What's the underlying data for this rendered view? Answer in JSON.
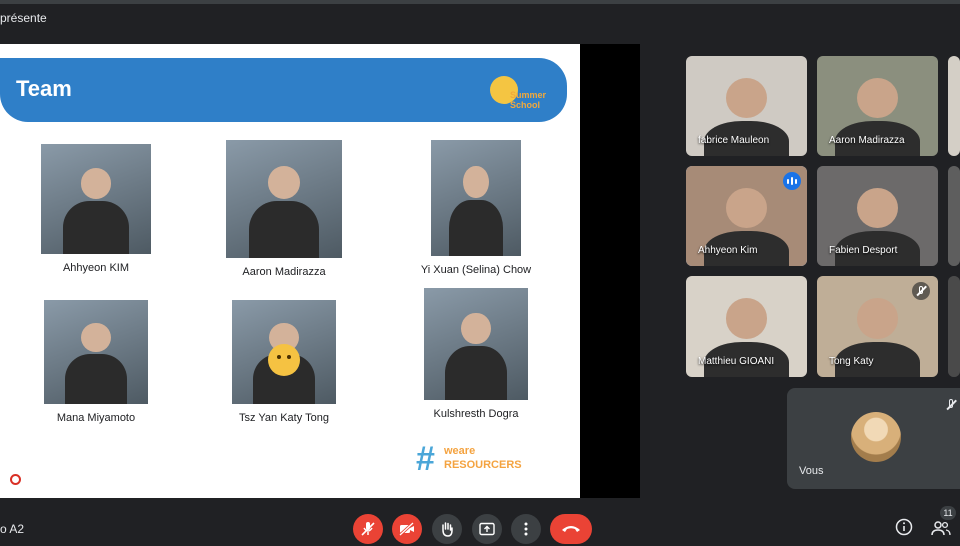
{
  "top_bar": {
    "presenting_label": "présente"
  },
  "slide": {
    "title": "Team",
    "logo_text": "Summer School",
    "hashtag_text": "weare RESOURCERS",
    "members": [
      {
        "name": "Ahhyeon KIM"
      },
      {
        "name": "Aaron Madirazza"
      },
      {
        "name": "Yi Xuan (Selina) Chow"
      },
      {
        "name": "Mana Miyamoto"
      },
      {
        "name": "Tsz Yan Katy Tong"
      },
      {
        "name": "Kulshresth Dogra"
      }
    ]
  },
  "participants": [
    {
      "name": "fabrice Mauleon",
      "speaking": false,
      "muted": false,
      "bg": "#cfcac3"
    },
    {
      "name": "Aaron Madirazza",
      "speaking": false,
      "muted": false,
      "bg": "#8b8f7e"
    },
    {
      "name": "Ahhyeon Kim",
      "speaking": true,
      "muted": false,
      "bg": "#a78b77"
    },
    {
      "name": "Fabien Desport",
      "speaking": false,
      "muted": false,
      "bg": "#6c6a6a"
    },
    {
      "name": "Matthieu GIOANI",
      "speaking": false,
      "muted": false,
      "bg": "#d8d2c8"
    },
    {
      "name": "Tong Katy",
      "speaking": false,
      "muted": true,
      "bg": "#bfae97"
    }
  ],
  "self_tile": {
    "name": "Vous",
    "muted": true
  },
  "bottom_bar": {
    "meeting_code": "o A2",
    "participant_count": "11"
  },
  "colors": {
    "slide_header": "#2f7fc8",
    "end_call": "#ea4335",
    "speaking_indicator": "#1a73e8",
    "meet_dark": "#202124"
  }
}
